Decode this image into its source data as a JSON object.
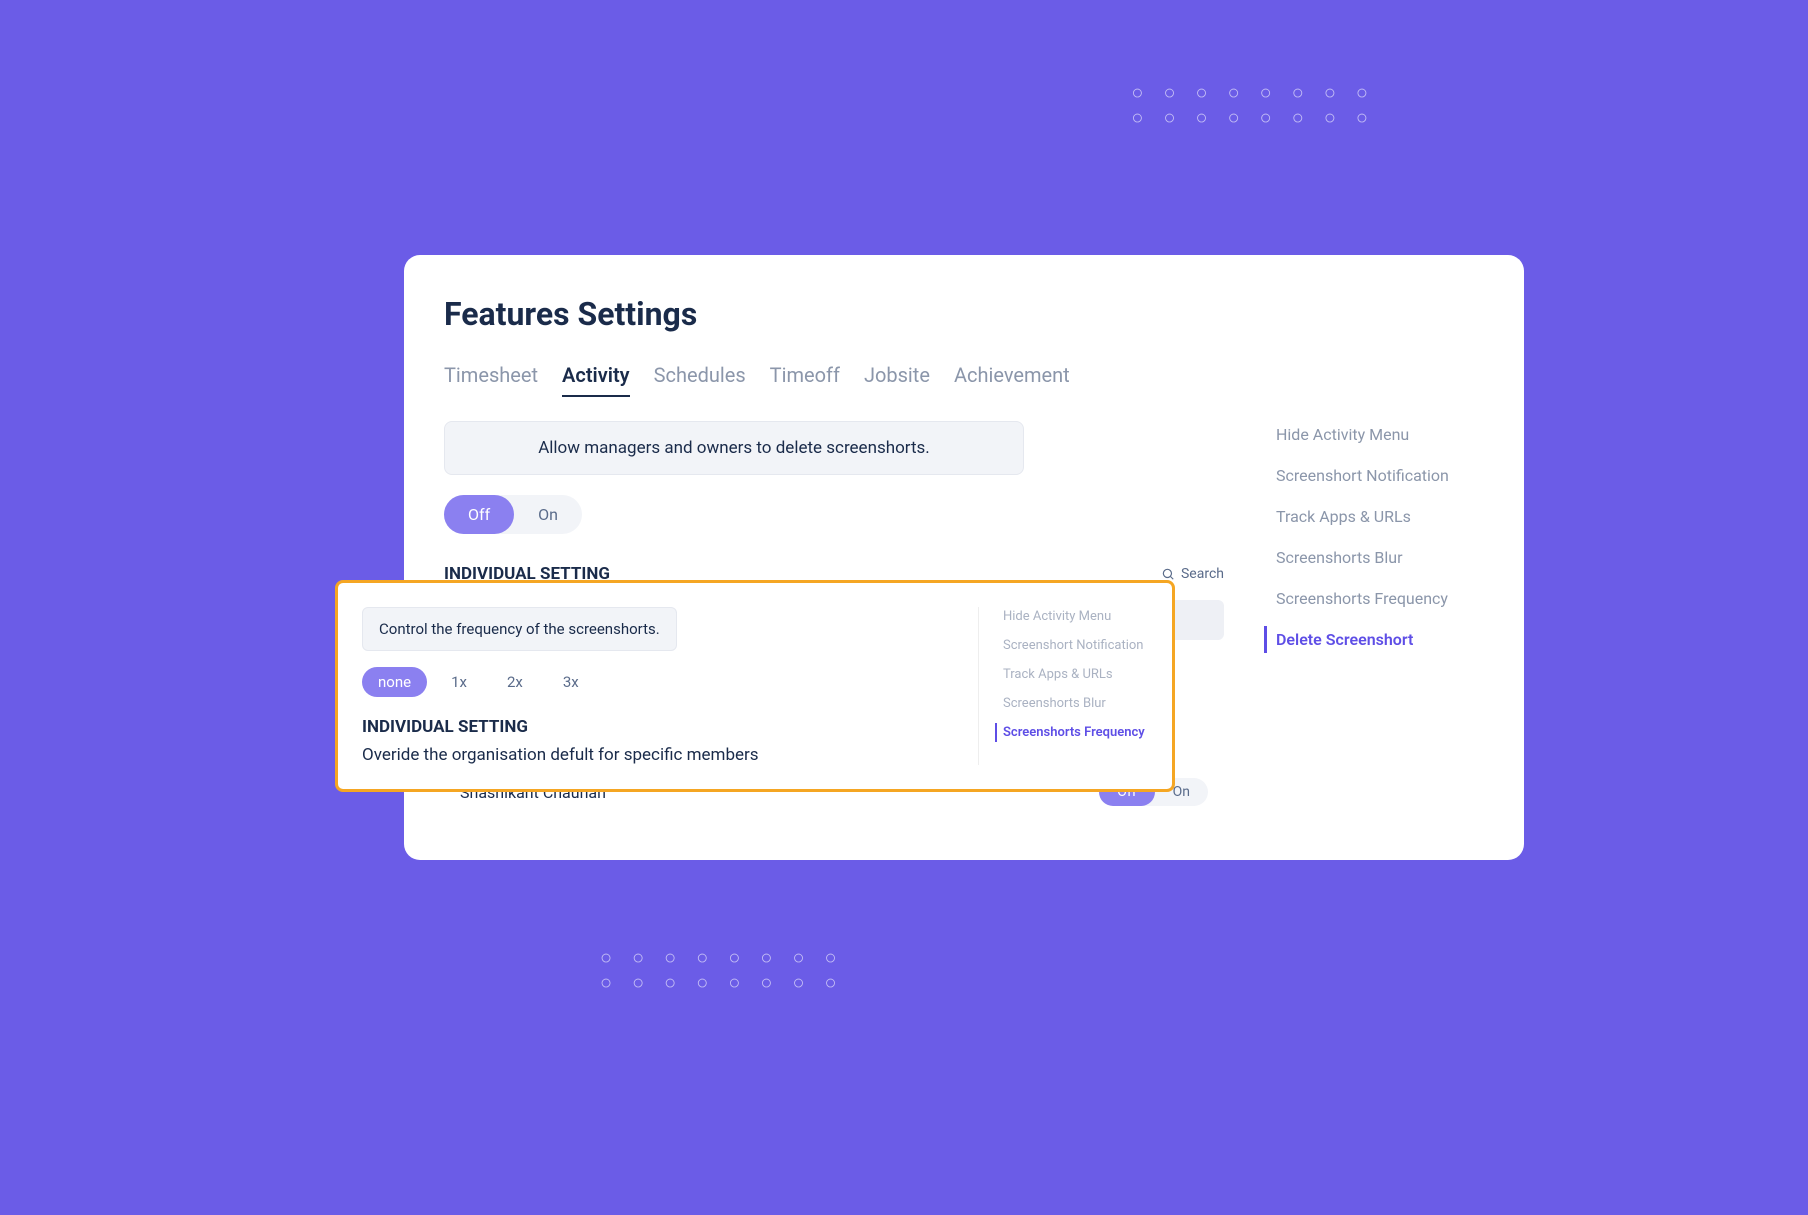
{
  "page": {
    "title": "Features Settings"
  },
  "tabs": [
    {
      "label": "Timesheet",
      "active": false
    },
    {
      "label": "Activity",
      "active": true
    },
    {
      "label": "Schedules",
      "active": false
    },
    {
      "label": "Timeoff",
      "active": false
    },
    {
      "label": "Jobsite",
      "active": false
    },
    {
      "label": "Achievement",
      "active": false
    }
  ],
  "mainSection": {
    "infoText": "Allow managers and owners to delete screenshorts.",
    "toggle": {
      "off": "Off",
      "on": "On",
      "active": "Off"
    },
    "individualSetting": {
      "heading": "INDIVIDUAL SETTING",
      "searchLabel": "Search"
    },
    "members": [
      {
        "name": "Shashikant Chauhan",
        "state": "Off"
      }
    ]
  },
  "sidebar": [
    {
      "label": "Hide Activity Menu",
      "active": false
    },
    {
      "label": "Screenshort Notification",
      "active": false
    },
    {
      "label": "Track Apps & URLs",
      "active": false
    },
    {
      "label": "Screenshorts Blur",
      "active": false
    },
    {
      "label": "Screenshorts Frequency",
      "active": false
    },
    {
      "label": "Delete Screenshort",
      "active": true
    }
  ],
  "overlay": {
    "infoText": "Control the frequency of the screenshorts.",
    "frequencies": [
      {
        "label": "none",
        "active": true
      },
      {
        "label": "1x",
        "active": false
      },
      {
        "label": "2x",
        "active": false
      },
      {
        "label": "3x",
        "active": false
      }
    ],
    "heading": "INDIVIDUAL SETTING",
    "description": "Overide the organisation defult for specific members",
    "sidebar": [
      {
        "label": "Hide Activity Menu",
        "active": false
      },
      {
        "label": "Screenshort Notification",
        "active": false
      },
      {
        "label": "Track Apps & URLs",
        "active": false
      },
      {
        "label": "Screenshorts Blur",
        "active": false
      },
      {
        "label": "Screenshorts Frequency",
        "active": true
      }
    ]
  }
}
